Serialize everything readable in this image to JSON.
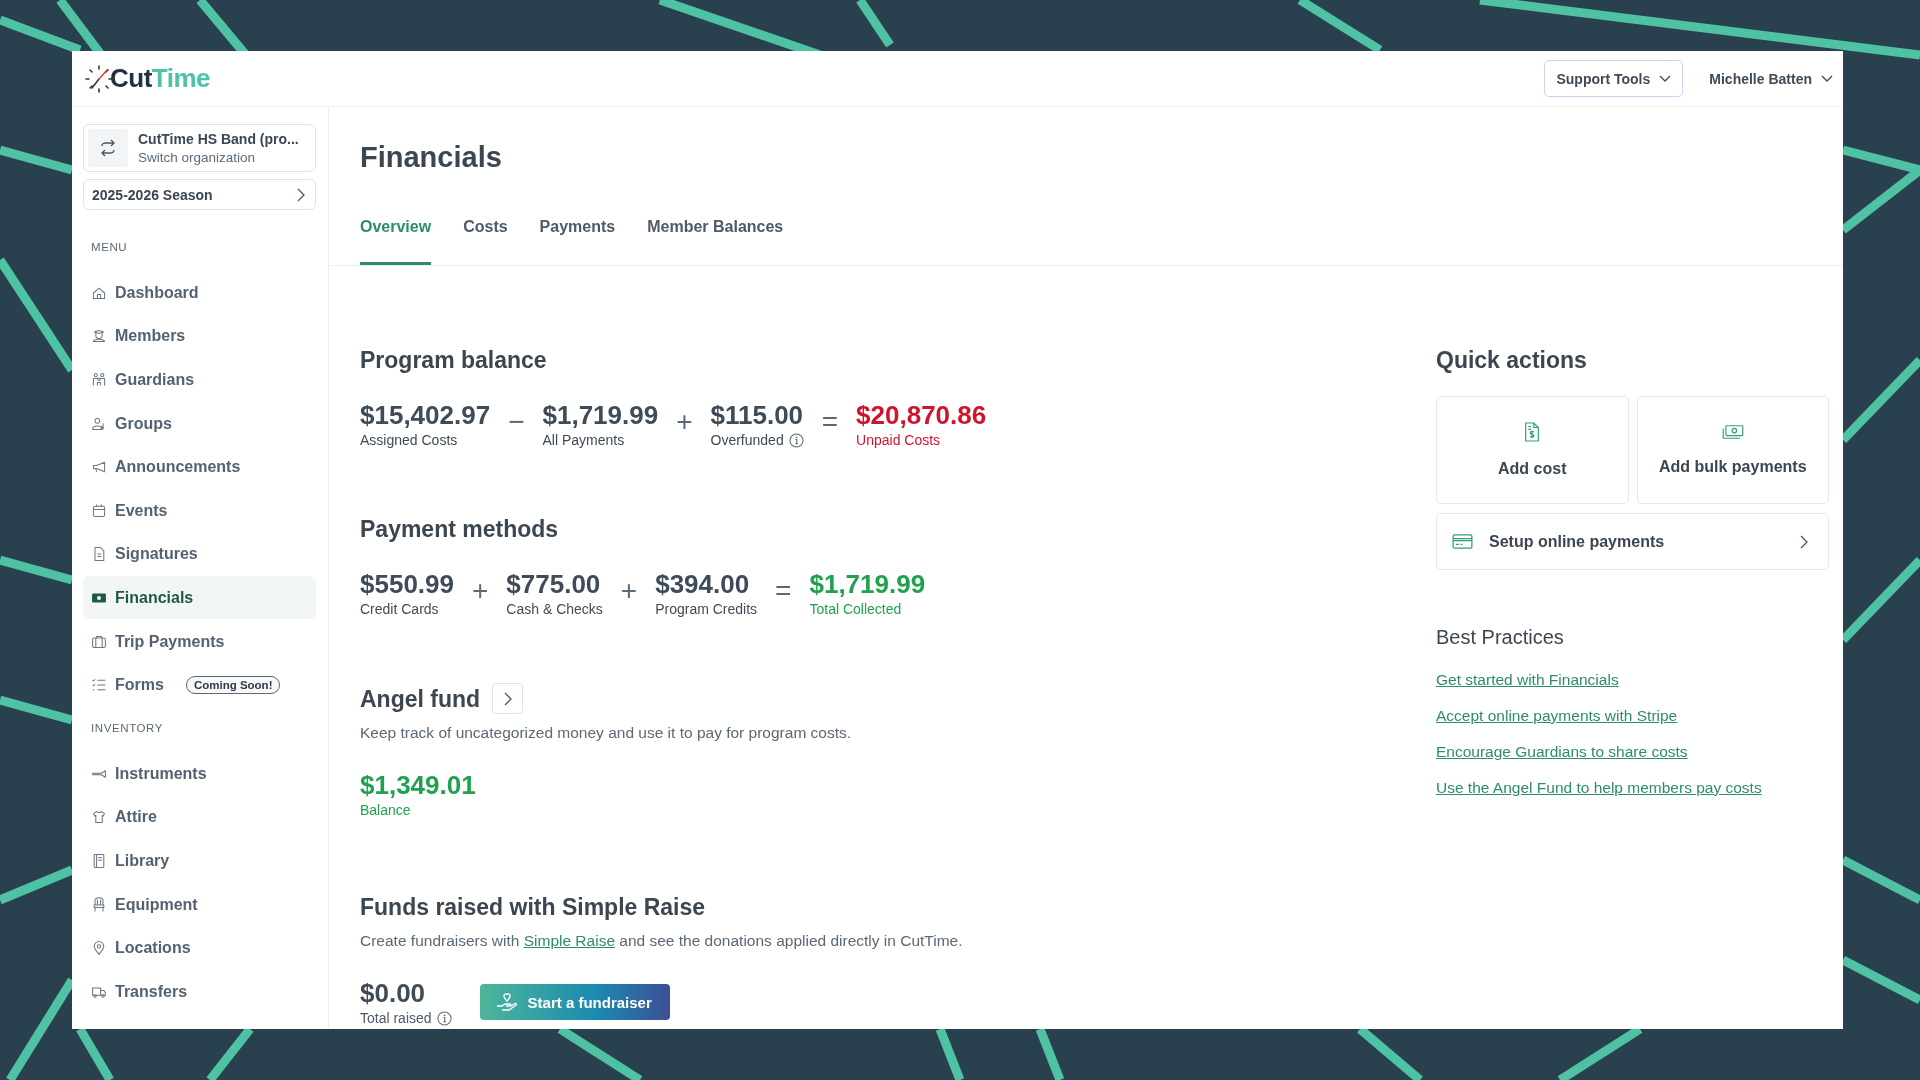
{
  "header": {
    "logo_dark": "Cut",
    "logo_accent": "Time",
    "support_tools": "Support Tools",
    "user": "Michelle Batten"
  },
  "sidebar": {
    "organization": {
      "name": "CutTime HS Band (pro...",
      "action": "Switch organization"
    },
    "season": "2025-2026 Season",
    "sections": [
      {
        "heading": "MENU",
        "items": [
          {
            "label": "Dashboard",
            "selected": false
          },
          {
            "label": "Members",
            "selected": false
          },
          {
            "label": "Guardians",
            "selected": false
          },
          {
            "label": "Groups",
            "selected": false
          },
          {
            "label": "Announcements",
            "selected": false
          },
          {
            "label": "Events",
            "selected": false
          },
          {
            "label": "Signatures",
            "selected": false
          },
          {
            "label": "Financials",
            "selected": true
          },
          {
            "label": "Trip Payments",
            "selected": false
          },
          {
            "label": "Forms",
            "selected": false,
            "badge": "Coming Soon!"
          }
        ]
      },
      {
        "heading": "INVENTORY",
        "items": [
          {
            "label": "Instruments",
            "selected": false
          },
          {
            "label": "Attire",
            "selected": false
          },
          {
            "label": "Library",
            "selected": false
          },
          {
            "label": "Equipment",
            "selected": false
          },
          {
            "label": "Locations",
            "selected": false
          },
          {
            "label": "Transfers",
            "selected": false
          }
        ]
      }
    ]
  },
  "page": {
    "title": "Financials",
    "tabs": [
      {
        "label": "Overview",
        "selected": true
      },
      {
        "label": "Costs",
        "selected": false
      },
      {
        "label": "Payments",
        "selected": false
      },
      {
        "label": "Member Balances",
        "selected": false
      }
    ]
  },
  "program_balance": {
    "title": "Program balance",
    "terms": [
      {
        "amount": "$15,402.97",
        "label": "Assigned Costs",
        "color": "#3f4b57",
        "info": false
      },
      {
        "operator": "−",
        "amount": "$1,719.99",
        "label": "All Payments",
        "color": "#3f4b57",
        "info": false
      },
      {
        "operator": "+",
        "amount": "$115.00",
        "label": "Overfunded",
        "color": "#3f4b57",
        "info": true
      },
      {
        "operator": "=",
        "amount": "$20,870.86",
        "label": "Unpaid Costs",
        "color": "#d0142c",
        "info": false
      }
    ]
  },
  "payment_methods": {
    "title": "Payment methods",
    "terms": [
      {
        "amount": "$550.99",
        "label": "Credit Cards",
        "color": "#3f4b57",
        "info": false
      },
      {
        "operator": "+",
        "amount": "$775.00",
        "label": "Cash & Checks",
        "color": "#3f4b57",
        "info": false
      },
      {
        "operator": "+",
        "amount": "$394.00",
        "label": "Program Credits",
        "color": "#3f4b57",
        "info": false
      },
      {
        "operator": "=",
        "amount": "$1,719.99",
        "label": "Total Collected",
        "color": "#21a150",
        "info": false
      }
    ]
  },
  "angel_fund": {
    "title": "Angel fund",
    "description": "Keep track of uncategorized money and use it to pay for program costs.",
    "amount": "$1,349.01",
    "label": "Balance"
  },
  "simple_raise": {
    "title": "Funds raised with Simple Raise",
    "description_before": "Create fundraisers with ",
    "link": "Simple Raise",
    "description_after": " and see the donations applied directly in CutTime.",
    "amount": "$0.00",
    "label": "Total raised",
    "button": "Start a fundraiser"
  },
  "quick_actions": {
    "title": "Quick actions",
    "tiles": [
      {
        "label": "Add cost"
      },
      {
        "label": "Add bulk payments"
      }
    ],
    "setup": "Setup online payments"
  },
  "best_practices": {
    "title": "Best Practices",
    "links": [
      "Get started with Financials",
      "Accept online payments with Stripe",
      "Encourage Guardians to share costs",
      "Use the Angel Fund to help members pay costs"
    ]
  }
}
